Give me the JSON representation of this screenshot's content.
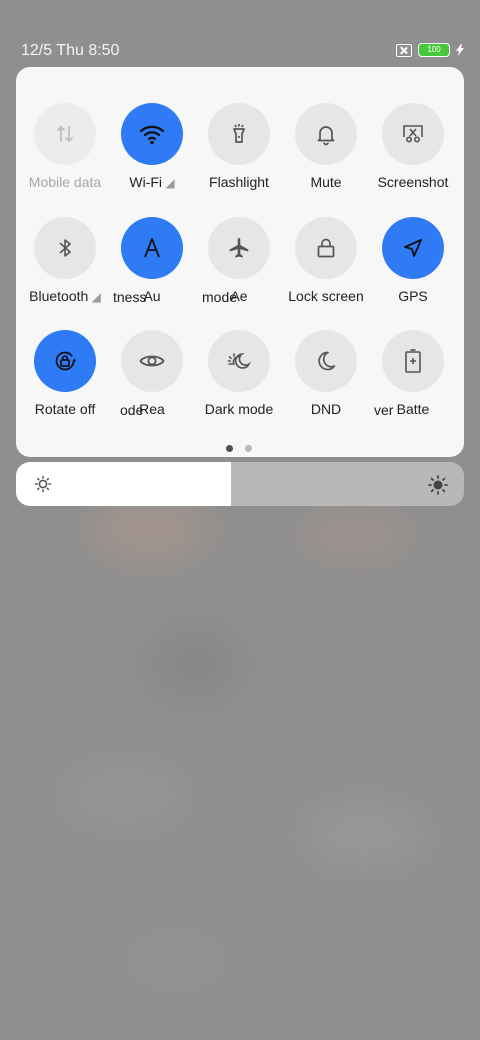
{
  "status_bar": {
    "time": "12/5 Thu 8:50",
    "battery": "100"
  },
  "tiles": [
    {
      "label": "Mobile data",
      "icon": "mobile-data-icon",
      "state": "disabled"
    },
    {
      "label": "Wi-Fi",
      "icon": "wifi-icon",
      "state": "active"
    },
    {
      "label": "Flashlight",
      "icon": "flashlight-icon",
      "state": "off"
    },
    {
      "label": "Mute",
      "icon": "bell-icon",
      "state": "off"
    },
    {
      "label": "Screenshot",
      "icon": "screenshot-icon",
      "state": "off"
    },
    {
      "label": "Bluetooth",
      "icon": "bluetooth-icon",
      "state": "off"
    },
    {
      "label": "Au",
      "icon": "auto-brightness-icon",
      "state": "active"
    },
    {
      "label": "Ae",
      "icon": "airplane-icon",
      "state": "off"
    },
    {
      "label": "Lock screen",
      "icon": "lock-icon",
      "state": "off"
    },
    {
      "label": "GPS",
      "icon": "location-arrow-icon",
      "state": "active"
    },
    {
      "label": "Rotate off",
      "icon": "rotate-lock-icon",
      "state": "active"
    },
    {
      "label": "Rea",
      "icon": "eye-icon",
      "state": "off"
    },
    {
      "label": "Dark mode",
      "icon": "dark-mode-icon",
      "state": "off"
    },
    {
      "label": "DND",
      "icon": "moon-icon",
      "state": "off"
    },
    {
      "label": "Batte",
      "icon": "battery-saver-icon",
      "state": "off"
    }
  ],
  "ghost_labels": {
    "row2_a": "tness",
    "row2_b": "mode",
    "row3_a": "ode",
    "row3_b": "ver"
  },
  "pager": {
    "pages": 2,
    "current": 1
  },
  "brightness": {
    "level": 0.48
  },
  "colors": {
    "active": "#2f7bf5",
    "inactive": "#e6e6e6",
    "panel": "#f7f7f7",
    "battery": "#46c93a"
  }
}
